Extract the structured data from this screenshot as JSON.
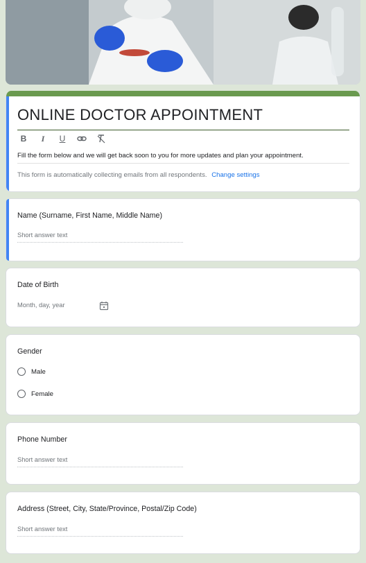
{
  "header": {
    "image_description_icon": "lab-photo"
  },
  "form": {
    "title": "ONLINE DOCTOR APPOINTMENT",
    "toolbar": {
      "bold": "B",
      "italic": "I",
      "underline": "U"
    },
    "description": "Fill the form below and we will get back soon to you for more updates and plan your appointment.",
    "notice": "This form is automatically collecting emails from all respondents.",
    "change_settings": "Change settings"
  },
  "questions": {
    "name": {
      "title": "Name (Surname, First Name, Middle Name)",
      "placeholder": "Short answer text"
    },
    "dob": {
      "title": "Date of Birth",
      "placeholder": "Month, day, year"
    },
    "gender": {
      "title": "Gender",
      "options": [
        "Male",
        "Female"
      ]
    },
    "phone": {
      "title": "Phone Number",
      "placeholder": "Short answer text"
    },
    "address": {
      "title": "Address (Street, City, State/Province, Postal/Zip Code)",
      "placeholder": "Short answer text"
    }
  },
  "colors": {
    "theme": "#6a9a4f",
    "accent": "#4285f4",
    "background": "#dde6d8",
    "link": "#1a73e8"
  }
}
